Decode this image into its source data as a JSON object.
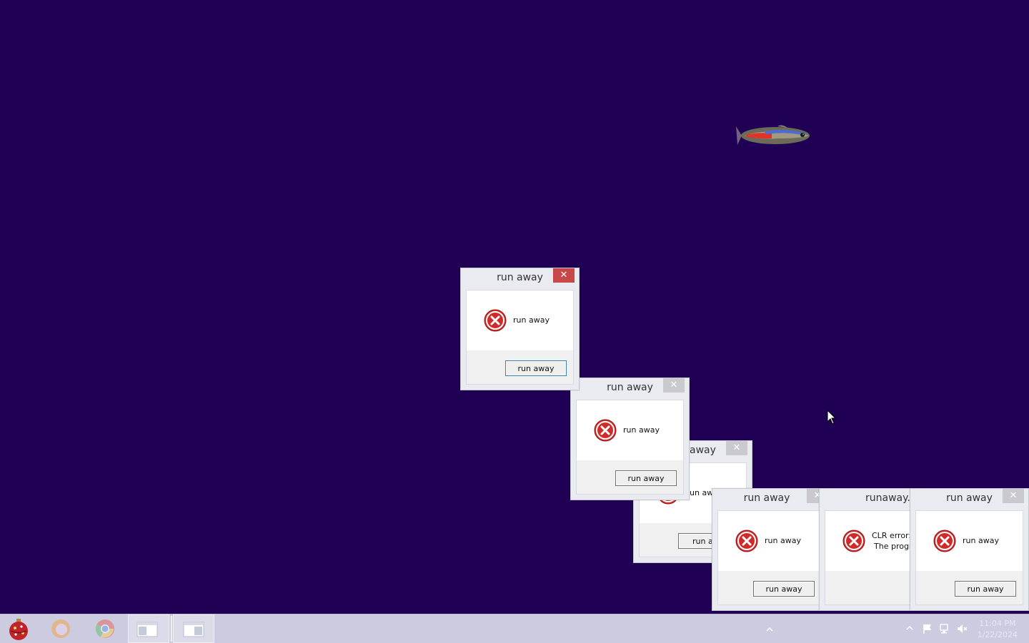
{
  "desktop": {
    "background": "#1f0055"
  },
  "dialogs": [
    {
      "title": "run away",
      "message": "run away",
      "button": "run away"
    },
    {
      "title": "run away",
      "message": "run away",
      "button": "run away"
    },
    {
      "title": "away",
      "message": "un aw",
      "button": "run a"
    },
    {
      "title": "run away",
      "message": "run away",
      "button": "run away"
    },
    {
      "title": "runaway.e",
      "message_line1": "CLR error:",
      "message_line2": "The progr"
    },
    {
      "title": "run away",
      "message": "run away",
      "button": "run away"
    }
  ],
  "taskbar": {
    "pinned": [
      "ornament-icon",
      "firefox-icon",
      "chrome-icon",
      "window-icon",
      "window-icon"
    ],
    "clock": {
      "time": "11:04 PM",
      "date": "1/22/2024"
    },
    "tray": [
      "chevron-up-icon",
      "flag-icon",
      "network-icon",
      "speaker-muted-icon"
    ]
  },
  "colors": {
    "accent_close": "#c84748",
    "error_red": "#d02b2b"
  }
}
